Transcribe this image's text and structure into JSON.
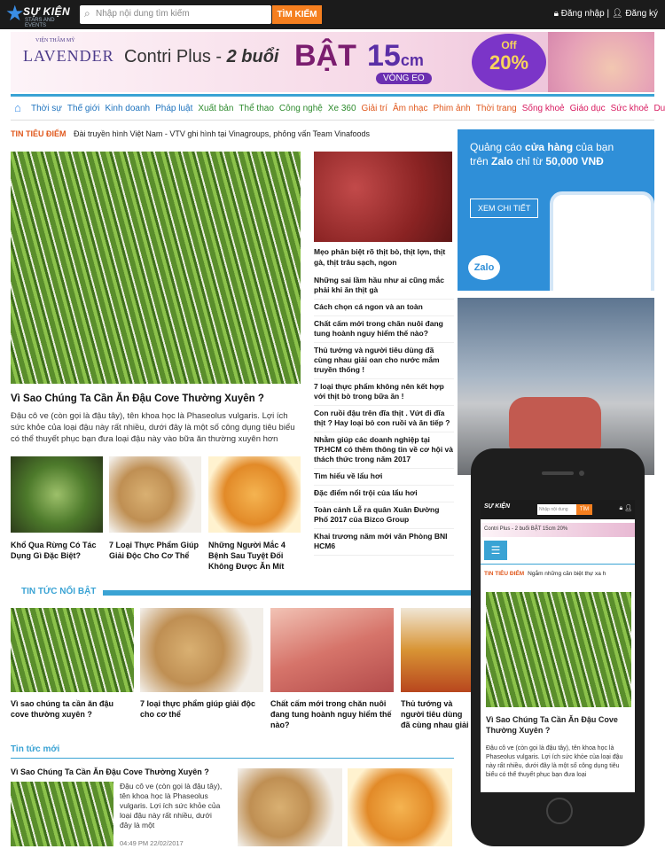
{
  "header": {
    "logo_text": "SỰ KIỆN",
    "logo_sub": "STARS AND EVENTS",
    "search_placeholder": "Nhập nội dung tìm kiếm",
    "search_button": "TÌM KIẾM",
    "login": "Đăng nhập",
    "register": "Đăng ký"
  },
  "banner": {
    "brand_small": "VIỆN THẨM MỸ",
    "brand": "LAVENDER",
    "product": "Contri Plus - ",
    "product_emph": "2 buổi",
    "bat": "BẬT",
    "cm": "15",
    "cm_unit": "cm",
    "vong_eo": "VÒNG EO",
    "off": "Off",
    "percent": "20%"
  },
  "nav": {
    "items": [
      {
        "label": "Thời sự",
        "color": "#1e73be"
      },
      {
        "label": "Thế giới",
        "color": "#1e73be"
      },
      {
        "label": "Kinh doanh",
        "color": "#1e73be"
      },
      {
        "label": "Pháp luật",
        "color": "#1e73be"
      },
      {
        "label": "Xuất bản",
        "color": "#2e8b2e"
      },
      {
        "label": "Thể thao",
        "color": "#2e8b2e"
      },
      {
        "label": "Công nghệ",
        "color": "#2e8b2e"
      },
      {
        "label": "Xe 360",
        "color": "#2e8b2e"
      },
      {
        "label": "Giải trí",
        "color": "#e0581d"
      },
      {
        "label": "Âm nhạc",
        "color": "#e0581d"
      },
      {
        "label": "Phim ảnh",
        "color": "#e0581d"
      },
      {
        "label": "Thời trang",
        "color": "#e0581d"
      },
      {
        "label": "Sống khoẻ",
        "color": "#d81b60"
      },
      {
        "label": "Giáo dục",
        "color": "#d81b60"
      },
      {
        "label": "Sức khoẻ",
        "color": "#d81b60"
      },
      {
        "label": "Du lịch",
        "color": "#d81b60"
      }
    ]
  },
  "ticker": {
    "label": "TIN TIÊU ĐIỂM",
    "text": "Đài truyền hình Việt Nam - VTV ghi hình tại Vinagroups, phỏng vấn Team Vinafoods"
  },
  "main_story": {
    "title": "Vì Sao Chúng Ta Cần Ăn Đậu Cove Thường Xuyên ?",
    "desc": "Đậu cô ve (còn gọi là đậu tây), tên khoa học là Phaseolus vulgaris. Lợi ích sức khỏe của loại đậu này rất nhiều, dưới đây là một số công dụng tiêu biểu có thể thuyết phục bạn đưa loại đậu này vào bữa ăn thường xuyên hơn"
  },
  "sub_stories": [
    "Khổ Qua Rừng Có Tác Dụng Gì Đặc Biệt?",
    "7 Loại Thực Phẩm Giúp Giải Độc Cho Cơ Thể",
    "Những Người Mắc 4 Bệnh Sau Tuyệt Đối Không Được Ăn Mít"
  ],
  "side_feature": "Mẹo phân biệt rõ thịt bò, thịt lợn, thịt gà, thịt trâu sạch, ngon",
  "side_list": [
    "Những sai lầm hầu như ai cũng mắc phải khi ăn thịt gà",
    "Cách chọn cá ngon và an toàn",
    "Chất cấm mới trong chăn nuôi đang tung hoành nguy hiểm thế nào?",
    "Thủ tướng và người tiêu dùng đã cùng nhau giải oan cho nước mắm truyền thống !",
    "7 loại thực phẩm không nên kết hợp với thịt bò trong bữa ăn !",
    "Con ruồi đậu trên đĩa thịt . Vứt đi đĩa thịt ? Hay loại bỏ con ruồi và ăn tiếp ?",
    "Nhằm giúp các doanh nghiệp tại TP.HCM có thêm thông tin về cơ hội và thách thức trong năm 2017",
    "Tìm hiểu về lẩu hơi",
    "Đặc điểm nổi trội của lẩu hơi",
    "Toàn cảnh Lễ ra quân Xuân Đường Phố 2017 của Bizco Group",
    "Khai trương năm mới văn Phòng BNI HCM6"
  ],
  "zalo_ad": {
    "line1": "Quảng cáo ",
    "line1b": "cửa hàng",
    "line1c": " của bạn",
    "line2": "trên ",
    "line2b": "Zalo",
    "line2c": " chỉ từ ",
    "line2d": "50,000 VNĐ",
    "button": "XEM CHI TIẾT",
    "logo": "Zalo"
  },
  "featured": {
    "title": "TIN TỨC NỔI BẬT",
    "items": [
      "Vì sao chúng ta cần ăn đậu cove thường xuyên ?",
      "7 loại thực phẩm giúp giải độc cho cơ thể",
      "Chất cấm mới trong chăn nuôi đang tung hoành nguy hiểm thế nào?",
      "Thủ tướng và người tiêu dùng đã cùng nhau giải oan cho nước mắm truyền thống !"
    ]
  },
  "latest": {
    "title": "Tin tức mới",
    "story_title": "Vì Sao Chúng Ta Cần Ăn Đậu Cove Thường Xuyên ?",
    "story_desc": "Đậu cô ve (còn gọi là đậu tây), tên khoa học là Phaseolus vulgaris. Lợi ích sức khỏe của loại đậu này rất nhiều, dưới đây là một",
    "time": "04:49 PM 22/02/2017"
  },
  "mobile": {
    "logo": "SỰ KIỆN",
    "search_placeholder": "Nhập nội dung",
    "search_button": "TÌM",
    "banner": "Contri Plus - 2 buổi BẬT 15cm 20%",
    "ticker_label": "TIN TIÊU ĐIỂM",
    "ticker_text": "Ngắm những căn biệt thự xa h",
    "title": "Vì Sao Chúng Ta Cần Ăn Đậu Cove Thường Xuyên ?",
    "desc": "Đậu cô ve (còn gọi là đậu tây), tên khoa học là Phaseolus vulgaris. Lợi ích sức khỏe của loại đậu này rất nhiều, dưới đây là một số công dụng tiêu biểu có thể thuyết phục bạn đưa loại"
  }
}
